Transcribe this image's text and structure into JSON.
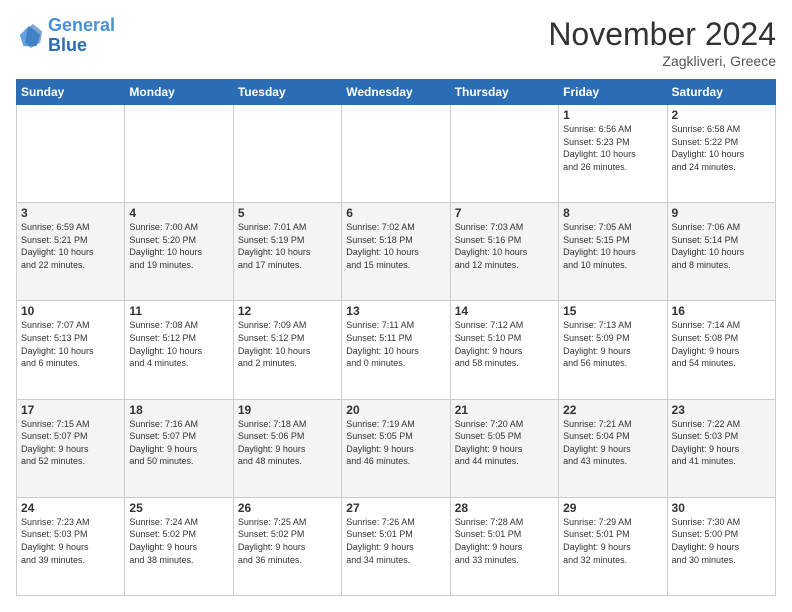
{
  "header": {
    "logo_line1": "General",
    "logo_line2": "Blue",
    "month_year": "November 2024",
    "location": "Zagkliveri, Greece"
  },
  "weekdays": [
    "Sunday",
    "Monday",
    "Tuesday",
    "Wednesday",
    "Thursday",
    "Friday",
    "Saturday"
  ],
  "weeks": [
    [
      {
        "day": "",
        "info": ""
      },
      {
        "day": "",
        "info": ""
      },
      {
        "day": "",
        "info": ""
      },
      {
        "day": "",
        "info": ""
      },
      {
        "day": "",
        "info": ""
      },
      {
        "day": "1",
        "info": "Sunrise: 6:56 AM\nSunset: 5:23 PM\nDaylight: 10 hours\nand 26 minutes."
      },
      {
        "day": "2",
        "info": "Sunrise: 6:58 AM\nSunset: 5:22 PM\nDaylight: 10 hours\nand 24 minutes."
      }
    ],
    [
      {
        "day": "3",
        "info": "Sunrise: 6:59 AM\nSunset: 5:21 PM\nDaylight: 10 hours\nand 22 minutes."
      },
      {
        "day": "4",
        "info": "Sunrise: 7:00 AM\nSunset: 5:20 PM\nDaylight: 10 hours\nand 19 minutes."
      },
      {
        "day": "5",
        "info": "Sunrise: 7:01 AM\nSunset: 5:19 PM\nDaylight: 10 hours\nand 17 minutes."
      },
      {
        "day": "6",
        "info": "Sunrise: 7:02 AM\nSunset: 5:18 PM\nDaylight: 10 hours\nand 15 minutes."
      },
      {
        "day": "7",
        "info": "Sunrise: 7:03 AM\nSunset: 5:16 PM\nDaylight: 10 hours\nand 12 minutes."
      },
      {
        "day": "8",
        "info": "Sunrise: 7:05 AM\nSunset: 5:15 PM\nDaylight: 10 hours\nand 10 minutes."
      },
      {
        "day": "9",
        "info": "Sunrise: 7:06 AM\nSunset: 5:14 PM\nDaylight: 10 hours\nand 8 minutes."
      }
    ],
    [
      {
        "day": "10",
        "info": "Sunrise: 7:07 AM\nSunset: 5:13 PM\nDaylight: 10 hours\nand 6 minutes."
      },
      {
        "day": "11",
        "info": "Sunrise: 7:08 AM\nSunset: 5:12 PM\nDaylight: 10 hours\nand 4 minutes."
      },
      {
        "day": "12",
        "info": "Sunrise: 7:09 AM\nSunset: 5:12 PM\nDaylight: 10 hours\nand 2 minutes."
      },
      {
        "day": "13",
        "info": "Sunrise: 7:11 AM\nSunset: 5:11 PM\nDaylight: 10 hours\nand 0 minutes."
      },
      {
        "day": "14",
        "info": "Sunrise: 7:12 AM\nSunset: 5:10 PM\nDaylight: 9 hours\nand 58 minutes."
      },
      {
        "day": "15",
        "info": "Sunrise: 7:13 AM\nSunset: 5:09 PM\nDaylight: 9 hours\nand 56 minutes."
      },
      {
        "day": "16",
        "info": "Sunrise: 7:14 AM\nSunset: 5:08 PM\nDaylight: 9 hours\nand 54 minutes."
      }
    ],
    [
      {
        "day": "17",
        "info": "Sunrise: 7:15 AM\nSunset: 5:07 PM\nDaylight: 9 hours\nand 52 minutes."
      },
      {
        "day": "18",
        "info": "Sunrise: 7:16 AM\nSunset: 5:07 PM\nDaylight: 9 hours\nand 50 minutes."
      },
      {
        "day": "19",
        "info": "Sunrise: 7:18 AM\nSunset: 5:06 PM\nDaylight: 9 hours\nand 48 minutes."
      },
      {
        "day": "20",
        "info": "Sunrise: 7:19 AM\nSunset: 5:05 PM\nDaylight: 9 hours\nand 46 minutes."
      },
      {
        "day": "21",
        "info": "Sunrise: 7:20 AM\nSunset: 5:05 PM\nDaylight: 9 hours\nand 44 minutes."
      },
      {
        "day": "22",
        "info": "Sunrise: 7:21 AM\nSunset: 5:04 PM\nDaylight: 9 hours\nand 43 minutes."
      },
      {
        "day": "23",
        "info": "Sunrise: 7:22 AM\nSunset: 5:03 PM\nDaylight: 9 hours\nand 41 minutes."
      }
    ],
    [
      {
        "day": "24",
        "info": "Sunrise: 7:23 AM\nSunset: 5:03 PM\nDaylight: 9 hours\nand 39 minutes."
      },
      {
        "day": "25",
        "info": "Sunrise: 7:24 AM\nSunset: 5:02 PM\nDaylight: 9 hours\nand 38 minutes."
      },
      {
        "day": "26",
        "info": "Sunrise: 7:25 AM\nSunset: 5:02 PM\nDaylight: 9 hours\nand 36 minutes."
      },
      {
        "day": "27",
        "info": "Sunrise: 7:26 AM\nSunset: 5:01 PM\nDaylight: 9 hours\nand 34 minutes."
      },
      {
        "day": "28",
        "info": "Sunrise: 7:28 AM\nSunset: 5:01 PM\nDaylight: 9 hours\nand 33 minutes."
      },
      {
        "day": "29",
        "info": "Sunrise: 7:29 AM\nSunset: 5:01 PM\nDaylight: 9 hours\nand 32 minutes."
      },
      {
        "day": "30",
        "info": "Sunrise: 7:30 AM\nSunset: 5:00 PM\nDaylight: 9 hours\nand 30 minutes."
      }
    ]
  ]
}
